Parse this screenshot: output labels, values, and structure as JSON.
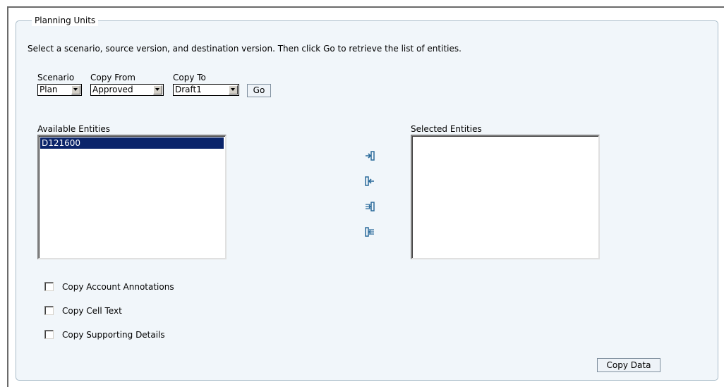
{
  "panel": {
    "title": "Planning Units",
    "instructions": "Select a scenario, source version, and destination version. Then click Go to retrieve the list of entities."
  },
  "selectors": {
    "scenario_label": "Scenario",
    "scenario_value": "Plan",
    "copy_from_label": "Copy From",
    "copy_from_value": "Approved",
    "copy_to_label": "Copy To",
    "copy_to_value": "Draft1",
    "go_label": "Go"
  },
  "available": {
    "label": "Available Entities",
    "items": [
      "D121600"
    ]
  },
  "selected": {
    "label": "Selected Entities",
    "items": []
  },
  "move_buttons": [
    "move-right-icon",
    "move-left-icon",
    "move-all-right-icon",
    "move-all-left-icon"
  ],
  "options": {
    "copy_account_annotations": "Copy Account Annotations",
    "copy_cell_text": "Copy Cell Text",
    "copy_supporting_details": "Copy Supporting Details"
  },
  "actions": {
    "copy_data_label": "Copy Data"
  },
  "colors": {
    "selection": "#0a246a",
    "panel_bg": "#f1f6fa",
    "panel_border": "#a9bcc9",
    "icon_blue": "#2a6a9a"
  }
}
